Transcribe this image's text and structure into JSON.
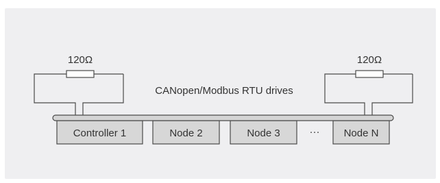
{
  "colors": {
    "background": "#efeff1",
    "line": "#4a4a4a",
    "box_fill": "#d7d7d7",
    "bus_fill": "#d4d4d4",
    "text": "#333333"
  },
  "terminators": {
    "left": {
      "label": "120Ω"
    },
    "right": {
      "label": "120Ω"
    }
  },
  "bus": {
    "label": "CANopen/Modbus RTU drives"
  },
  "nodes": [
    {
      "label": "Controller 1"
    },
    {
      "label": "Node 2"
    },
    {
      "label": "Node 3"
    },
    {
      "label": "Node N"
    }
  ],
  "ellipsis": "···"
}
